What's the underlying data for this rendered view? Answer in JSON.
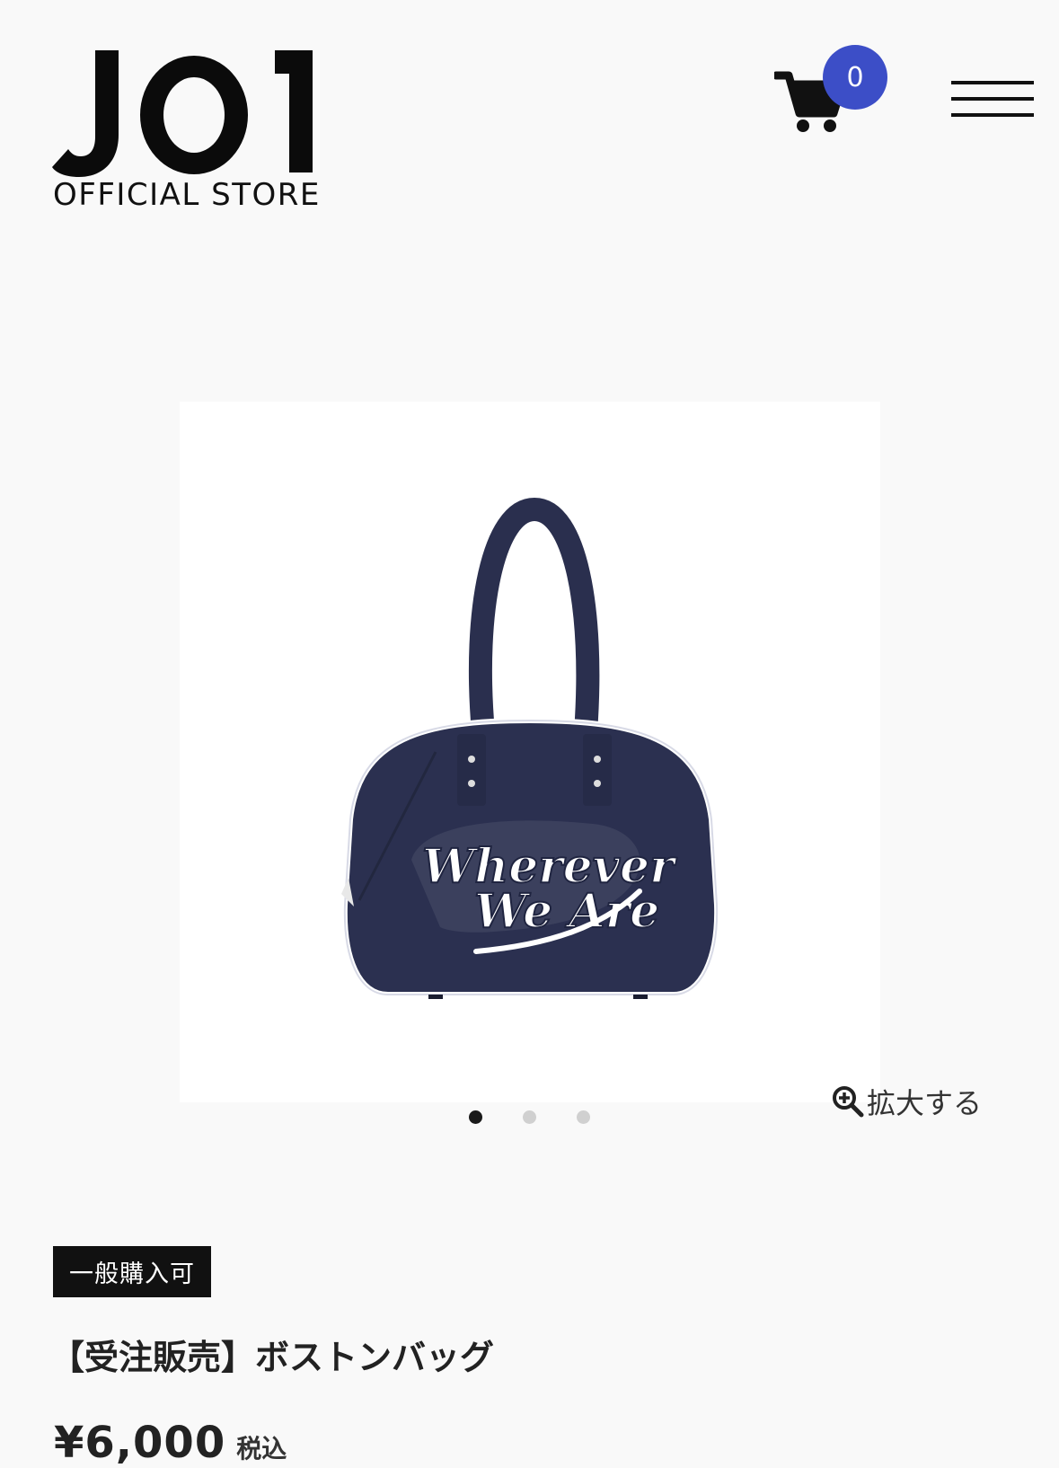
{
  "header": {
    "logo_text": "JO1",
    "logo_subtitle": "OFFICIAL STORE",
    "cart_count": "0"
  },
  "product": {
    "image_text_line1": "Wherever",
    "image_text_line2": "We Are",
    "zoom_label": "拡大する",
    "carousel": {
      "count": 3,
      "active_index": 0
    },
    "badge": "一般購入可",
    "title": "【受注販売】ボストンバッグ",
    "price": "¥6,000",
    "tax_label": "税込"
  },
  "colors": {
    "accent": "#3c4ec7",
    "bag_navy": "#2a2f4e",
    "text": "#111111"
  }
}
